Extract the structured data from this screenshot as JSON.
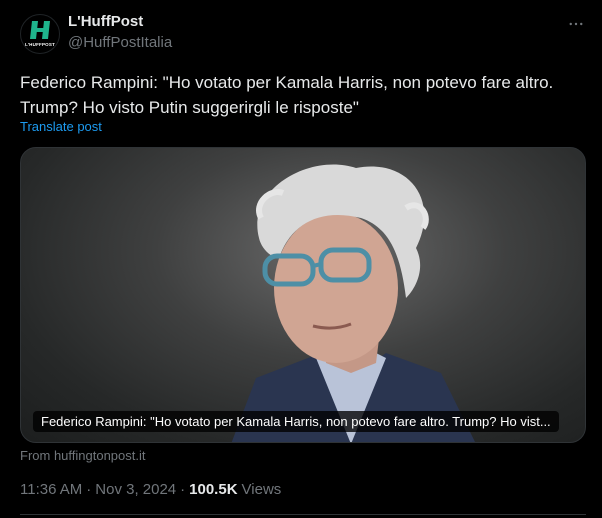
{
  "account": {
    "name": "L'HuffPost",
    "handle": "@HuffPostItalia",
    "logo_caption": "L'HUFFPOST",
    "brand_color": "#1fb48c"
  },
  "tweet": {
    "text": "Federico Rampini: \"Ho votato per Kamala Harris, non potevo fare altro. Trump? Ho visto Putin suggerirgli le risposte\"",
    "translate_label": "Translate post"
  },
  "card": {
    "caption": "Federico Rampini: \"Ho votato per Kamala Harris, non potevo fare altro. Trump? Ho vist...",
    "source": "From huffingtonpost.it"
  },
  "meta": {
    "time": "11:36 AM",
    "date": "Nov 3, 2024",
    "views_count": "100.5K",
    "views_label": "Views",
    "separator": "·"
  },
  "icons": {
    "more": "more-horizontal-icon",
    "logo": "huffpost-logo-icon"
  },
  "colors": {
    "background": "#000000",
    "text": "#e7e9ea",
    "secondary": "#71767b",
    "link": "#1d9bf0"
  }
}
